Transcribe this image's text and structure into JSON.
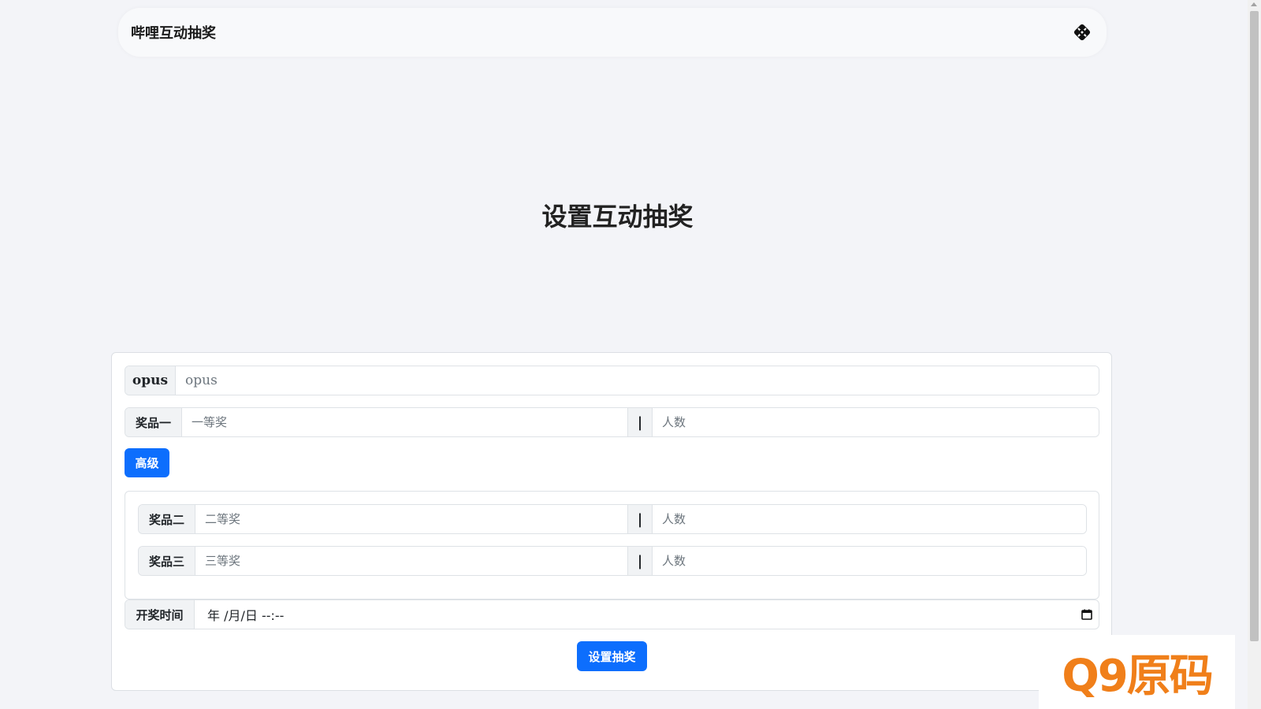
{
  "navbar": {
    "brand": "哔哩互动抽奖",
    "theme_icon": "theme-toggle-icon"
  },
  "page": {
    "title": "设置互动抽奖"
  },
  "form": {
    "opus": {
      "label": "opus",
      "placeholder": "opus"
    },
    "prize1": {
      "label": "奖品一",
      "placeholder": "一等奖",
      "separator": "|",
      "count_placeholder": "人数"
    },
    "advanced_button": "高级",
    "prize2": {
      "label": "奖品二",
      "placeholder": "二等奖",
      "separator": "|",
      "count_placeholder": "人数"
    },
    "prize3": {
      "label": "奖品三",
      "placeholder": "三等奖",
      "separator": "|",
      "count_placeholder": "人数"
    },
    "draw_time": {
      "label": "开奖时间",
      "value": "年 /月/日 --:--",
      "icon": "calendar-icon"
    },
    "submit_button": "设置抽奖"
  },
  "watermark": {
    "logo_text": "Q9原码"
  },
  "colors": {
    "primary": "#0d6efd",
    "background": "#f3f4f8",
    "watermark": "#f08a1c"
  }
}
